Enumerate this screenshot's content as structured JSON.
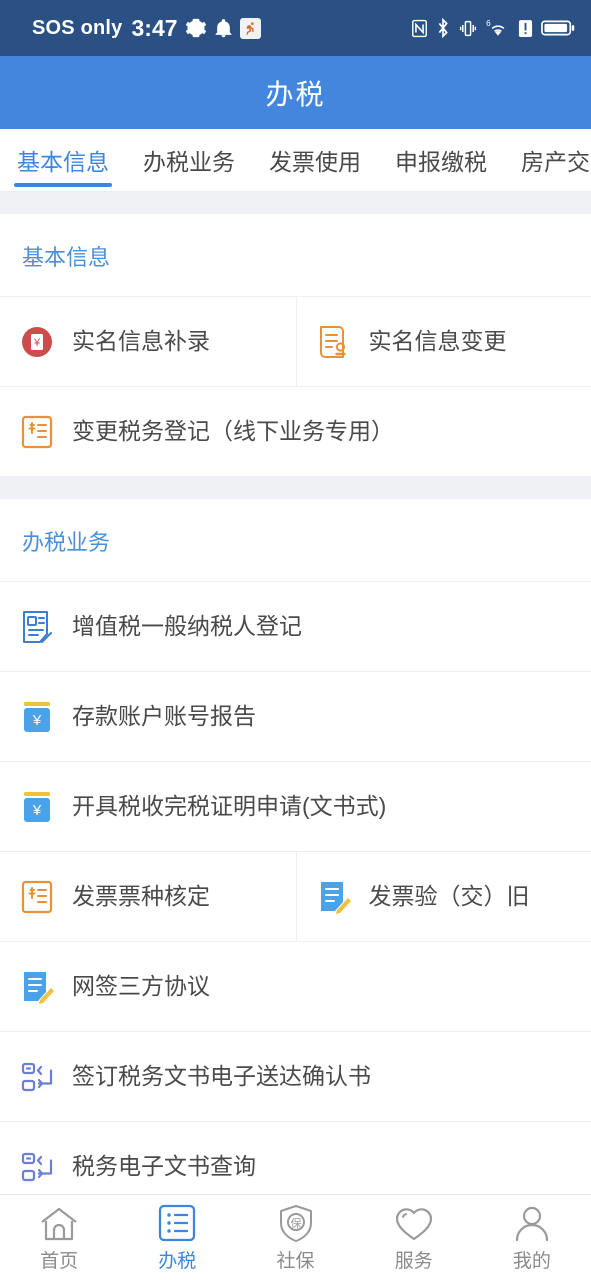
{
  "status_bar": {
    "carrier": "SOS only",
    "time": "3:47",
    "left_icons": [
      "gear-icon",
      "bell-icon",
      "runner-icon"
    ],
    "right_icons": [
      "nfc-icon",
      "bluetooth-icon",
      "vibrate-icon",
      "wifi6-icon",
      "sim-alert-icon",
      "battery-icon"
    ]
  },
  "header": {
    "title": "办税"
  },
  "tabs": [
    {
      "label": "基本信息",
      "active": true
    },
    {
      "label": "办税业务",
      "active": false
    },
    {
      "label": "发票使用",
      "active": false
    },
    {
      "label": "申报缴税",
      "active": false
    },
    {
      "label": "房产交",
      "active": false
    }
  ],
  "sections": [
    {
      "title": "基本信息",
      "rows": [
        [
          {
            "label": "实名信息补录",
            "icon": "red-yen-circle-icon"
          },
          {
            "label": "实名信息变更",
            "icon": "orange-seal-document-icon"
          }
        ],
        [
          {
            "label": "变更税务登记（线下业务专用）",
            "icon": "orange-invoice-icon"
          }
        ]
      ]
    },
    {
      "title": "办税业务",
      "rows": [
        [
          {
            "label": "增值税一般纳税人登记",
            "icon": "blue-zeng-document-icon"
          }
        ],
        [
          {
            "label": "存款账户账号报告",
            "icon": "blue-yen-book-icon"
          }
        ],
        [
          {
            "label": "开具税收完税证明申请(文书式)",
            "icon": "blue-yen-book-icon"
          }
        ],
        [
          {
            "label": "发票票种核定",
            "icon": "orange-invoice-icon"
          },
          {
            "label": "发票验（交）旧",
            "icon": "blue-pen-document-icon"
          }
        ],
        [
          {
            "label": "网签三方协议",
            "icon": "blue-pen-document-icon"
          }
        ],
        [
          {
            "label": "签订税务文书电子送达确认书",
            "icon": "transfer-arrows-icon"
          }
        ],
        [
          {
            "label": "税务电子文书查询",
            "icon": "transfer-arrows-icon"
          }
        ]
      ]
    }
  ],
  "bottom_nav": [
    {
      "label": "首页",
      "icon": "home-icon",
      "active": false
    },
    {
      "label": "办税",
      "icon": "list-icon",
      "active": true
    },
    {
      "label": "社保",
      "icon": "shield-bao-icon",
      "active": false
    },
    {
      "label": "服务",
      "icon": "heart-icon",
      "active": false
    },
    {
      "label": "我的",
      "icon": "person-icon",
      "active": false
    }
  ],
  "colors": {
    "status_bar": "#2a5084",
    "title_bar": "#4287dd",
    "accent": "#3c86db",
    "section_title": "#4a90d9",
    "page_bg": "#eef0f4",
    "orange": "#e8913a",
    "red": "#cf4b4b",
    "gold": "#f0c040",
    "periwinkle": "#6b7fd7"
  }
}
